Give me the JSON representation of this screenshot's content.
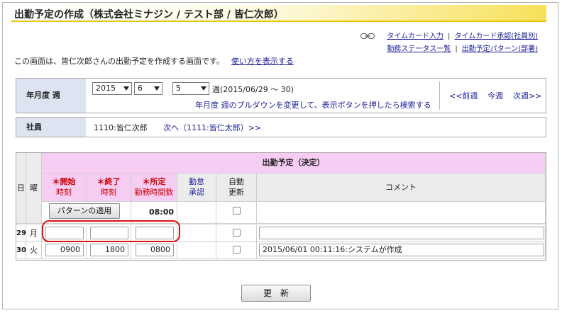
{
  "title": "出勤予定の作成（株式会社ミナジン / テスト部 / 皆仁次郎）",
  "links_row1": [
    "タイムカード入力",
    "タイムカード承認(社員別)"
  ],
  "links_row2": [
    "勤務ステータス一覧",
    "出勤予定パターン(部署)"
  ],
  "link_separator": "|",
  "description": "この画面は、皆仁次郎さんの出勤予定を作成する画面です。",
  "howto_link": "使い方を表示する",
  "week": {
    "label": "年月度 週",
    "year": "2015",
    "month": "6",
    "week_no": "5",
    "week_suffix": "週(2015/06/29 ～ 30)",
    "hint": "年月度 週のプルダウンを変更して、表示ボタンを押したら検索する",
    "prev": "<<前週",
    "current": "今週",
    "next": "次週>>"
  },
  "employee": {
    "label": "社員",
    "value": "1110:皆仁次郎",
    "next_link": "次へ（1111:皆仁太郎）>>"
  },
  "table": {
    "group_header": "出勤予定（決定）",
    "col_day": "日",
    "col_weekday": "曜",
    "req_mark": "＊",
    "col_start_1": "開始",
    "col_start_2": "時刻",
    "col_end_1": "終了",
    "col_end_2": "時刻",
    "col_req_1": "所定",
    "col_req_2": "勤務時間数",
    "col_approve_1": "勤怠",
    "col_approve_2": "承認",
    "col_auto_1": "自動",
    "col_auto_2": "更新",
    "col_comment": "コメント",
    "pattern_button": "パターンの適用",
    "pattern_hours": "08:00",
    "rows": [
      {
        "day": "29",
        "weekday": "月",
        "start": "",
        "end": "",
        "hours": "",
        "comment": ""
      },
      {
        "day": "30",
        "weekday": "火",
        "start": "0900",
        "end": "1800",
        "hours": "0800",
        "comment": "2015/06/01 00:11:16:システムが作成"
      }
    ]
  },
  "update_button": "更　新"
}
